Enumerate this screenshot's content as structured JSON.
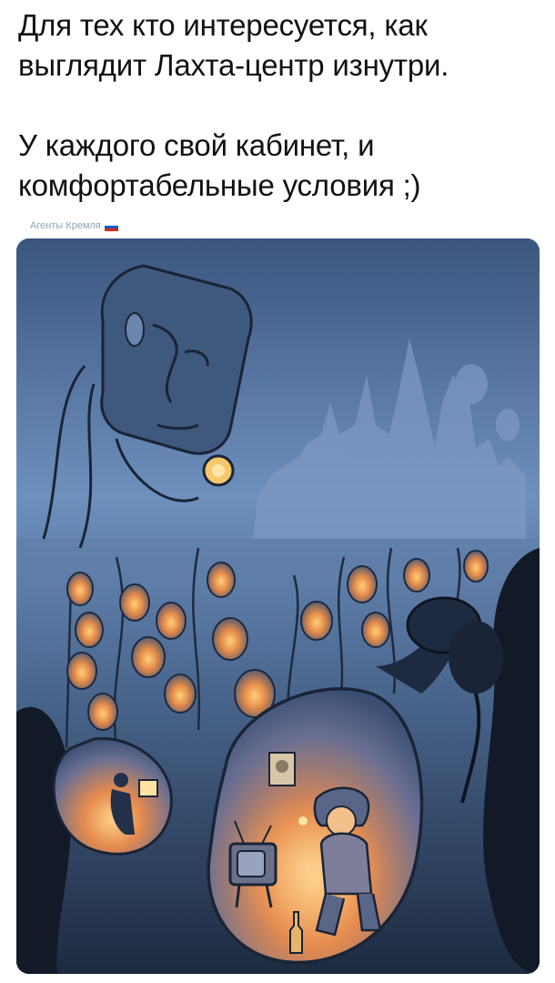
{
  "post": {
    "line1": "Для тех кто интересуется, как",
    "line2": "выглядит Лахта-центр изнутри.",
    "line3": "У каждого свой кабинет, и",
    "line4": "комфортабельные условия ;)"
  },
  "source": {
    "label": "Агенты Кремля",
    "flag_colors": [
      "#ffffff",
      "#1c57c9",
      "#d52b1e"
    ]
  },
  "illustration": {
    "subject": "cartoon-illustration",
    "palette": {
      "sky": "#5d7fae",
      "night": "#1d2a40",
      "glow": "#f2a65a",
      "warm": "#ffcf7a"
    }
  }
}
